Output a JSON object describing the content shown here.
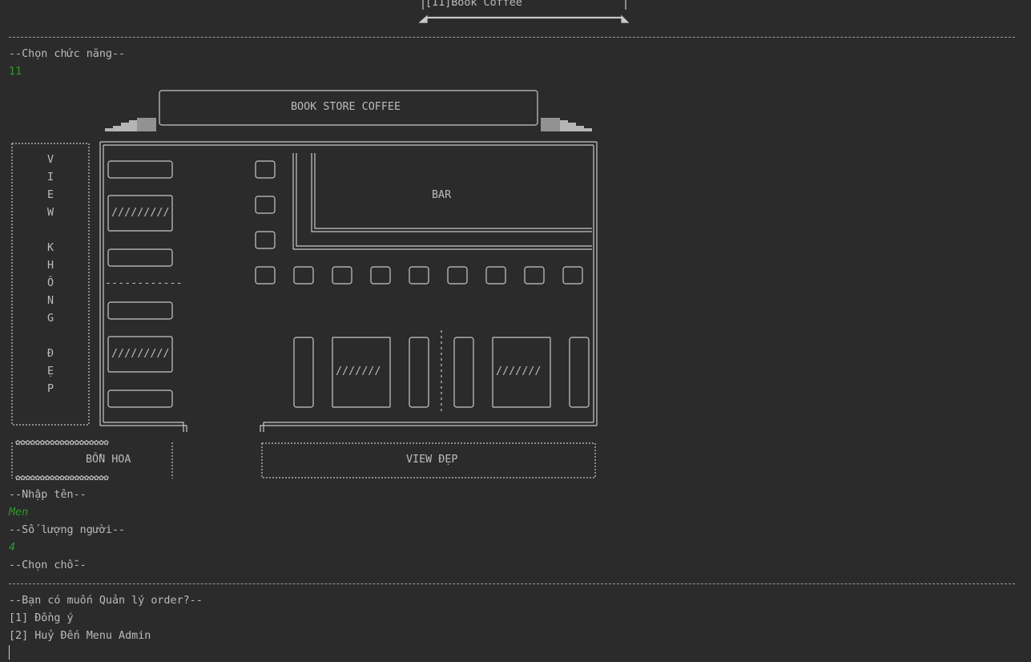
{
  "header": {
    "option_fragment": "[11]Book Coffee"
  },
  "prompts": {
    "choose_function": "--Chọn chức năng--",
    "function_input": "11",
    "enter_name": "--Nhập tên--",
    "name_input": "Men",
    "people_count": "--Số lượng người--",
    "people_input": "4",
    "choose_seat": "--Chọn chỗ--",
    "manage_order_question": "--Bạn có muốn Quản lý order?--",
    "option_agree": "[1] Đồng ý",
    "option_cancel": "[2] Huỷ Đến Menu Admin"
  },
  "floor_plan": {
    "sign": "BOOK STORE COFFEE",
    "bar": "BAR",
    "view_letters": [
      "V",
      "I",
      "E",
      "W",
      "",
      "K",
      "H",
      "Ô",
      "N",
      "G",
      "",
      "Đ",
      "Ẹ",
      "P"
    ],
    "flower_pot": "BỒN HOA",
    "flower_row": "✿✿✿✿✿✿✿✿✿✿✿✿✿✿✿✿✿✿✿",
    "nice_view": "VIEW ĐẸP",
    "table_hatch_long": "/////////",
    "table_hatch_short": "///////",
    "divider": "------------"
  }
}
